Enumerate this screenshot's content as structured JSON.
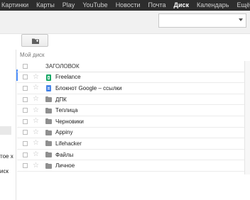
{
  "topbar": {
    "items": [
      {
        "label": "Картинки",
        "active": false
      },
      {
        "label": "Карты",
        "active": false
      },
      {
        "label": "Play",
        "active": false
      },
      {
        "label": "YouTube",
        "active": false
      },
      {
        "label": "Новости",
        "active": false
      },
      {
        "label": "Почта",
        "active": false
      },
      {
        "label": "Диск",
        "active": true
      },
      {
        "label": "Календарь",
        "active": false
      },
      {
        "label": "Ещё",
        "active": false
      }
    ]
  },
  "toolbar": {
    "new_folder_icon": "folder-plus-icon"
  },
  "sidebar": {
    "partial_texts": [
      "тое х",
      "иск"
    ]
  },
  "main": {
    "section_label": "Мой диск",
    "header_label": "ЗАГОЛОВОК",
    "items": [
      {
        "name": "Freelance",
        "type": "spreadsheet",
        "icon": "spreadsheet-icon"
      },
      {
        "name": "Блокнот Google – ссылки",
        "type": "document",
        "icon": "document-icon"
      },
      {
        "name": "ДПК",
        "type": "folder",
        "icon": "folder-icon"
      },
      {
        "name": "Теплица",
        "type": "folder",
        "icon": "folder-icon"
      },
      {
        "name": "Черновики",
        "type": "folder",
        "icon": "folder-icon"
      },
      {
        "name": "Appiny",
        "type": "folder",
        "icon": "folder-icon"
      },
      {
        "name": "Lifehacker",
        "type": "folder",
        "icon": "folder-icon"
      },
      {
        "name": "Файлы",
        "type": "folder",
        "icon": "folder-icon"
      },
      {
        "name": "Личное",
        "type": "folder",
        "icon": "folder-icon"
      }
    ]
  },
  "colors": {
    "topbar_bg": "#2d2d2d",
    "accent_blue": "#4d90fe",
    "spreadsheet_green": "#16a765",
    "document_blue": "#4a86e8",
    "folder_gray": "#8f8f8f"
  }
}
